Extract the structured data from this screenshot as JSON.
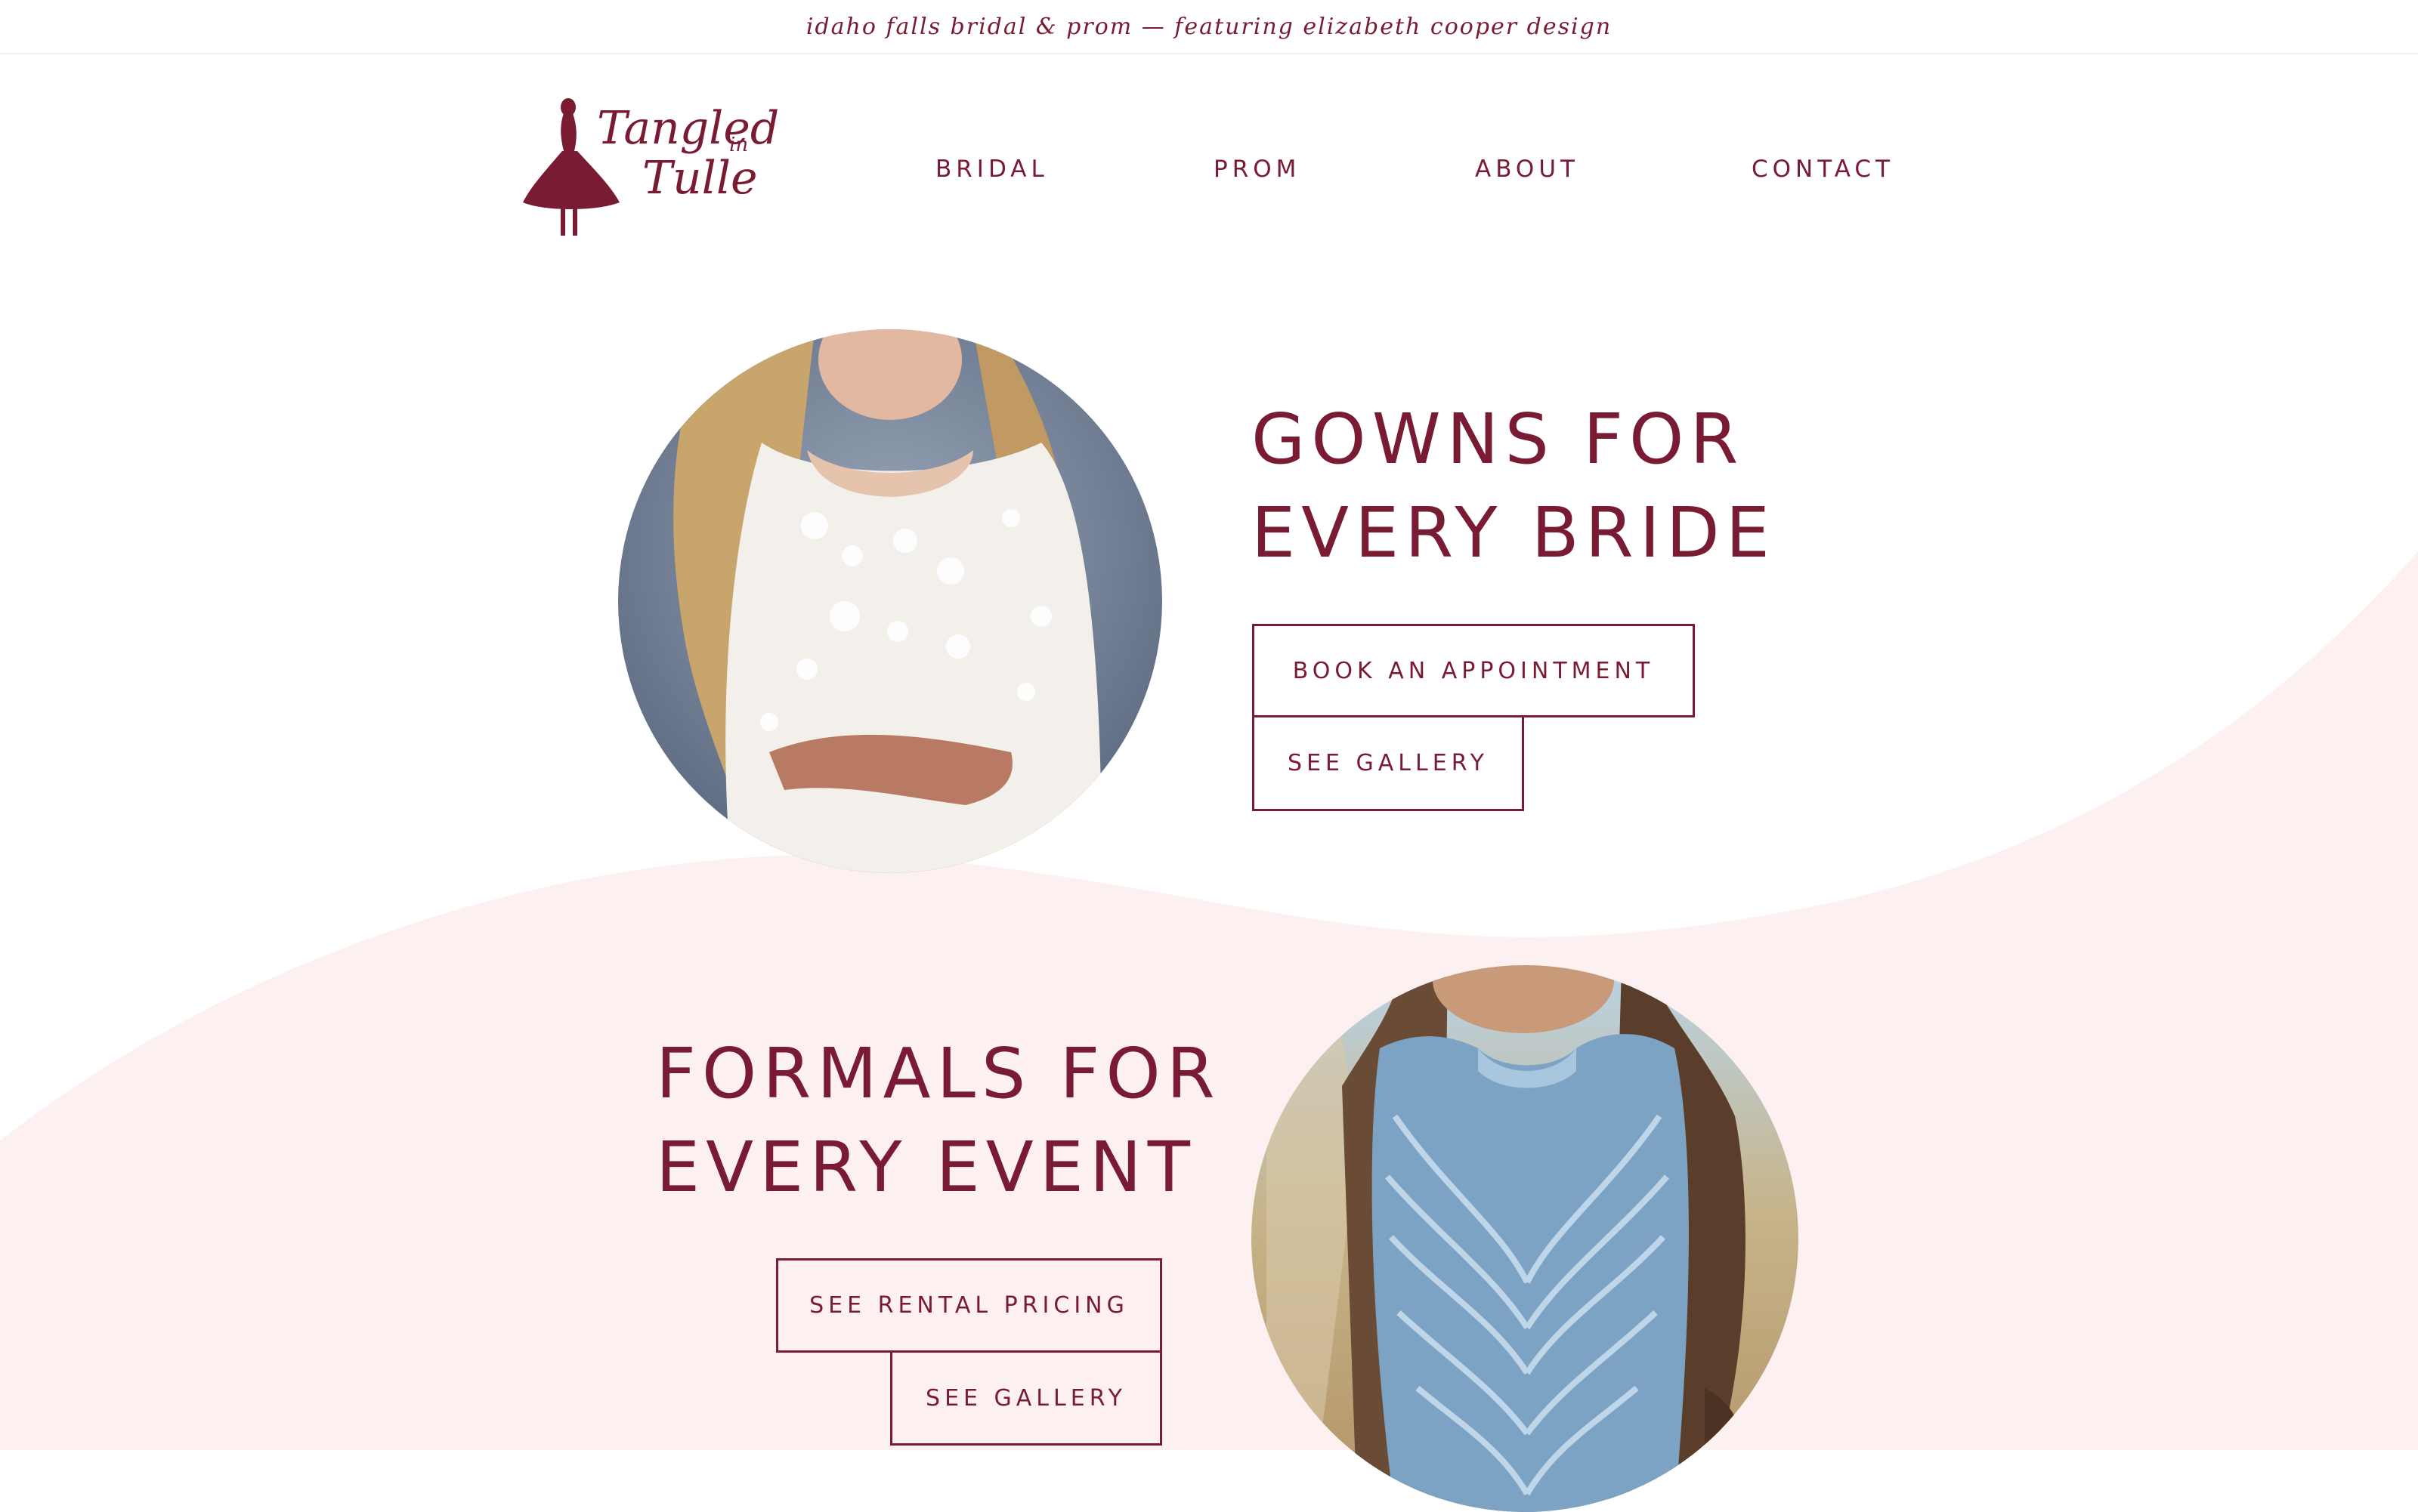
{
  "announcement": "idaho falls bridal & prom — featuring elizabeth cooper design",
  "brand": {
    "logo_line1": "Tangled",
    "logo_in": "in",
    "logo_line2": "Tulle",
    "color": "#7a1b34"
  },
  "nav": {
    "items": [
      {
        "label": "BRIDAL"
      },
      {
        "label": "PROM"
      },
      {
        "label": "ABOUT"
      },
      {
        "label": "CONTACT"
      }
    ]
  },
  "section_bridal": {
    "heading_line1": "GOWNS FOR",
    "heading_line2": "EVERY BRIDE",
    "primary_button": "BOOK AN APPOINTMENT",
    "secondary_button": "SEE GALLERY",
    "image_icon": "bride-lace-gown-photo"
  },
  "section_formal": {
    "heading_line1": "FORMALS FOR",
    "heading_line2": "EVERY EVENT",
    "primary_button": "SEE RENTAL PRICING",
    "secondary_button": "SEE GALLERY",
    "image_icon": "blue-sequin-dress-photo"
  },
  "colors": {
    "accent": "#7a1b34",
    "wave": "#fcf0f1",
    "background": "#ffffff"
  }
}
